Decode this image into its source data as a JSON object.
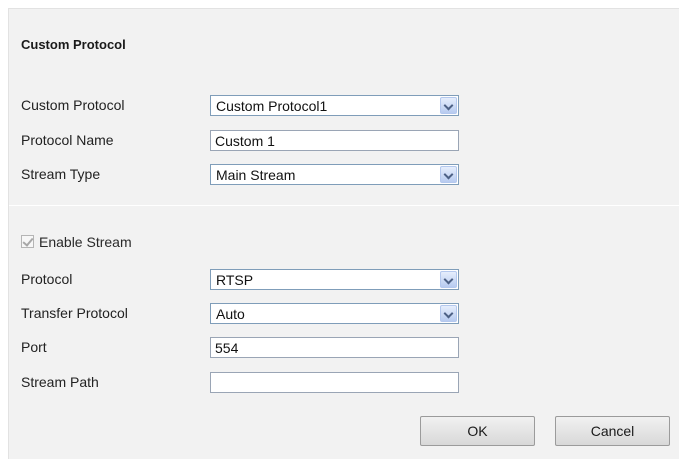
{
  "section_title": "Custom Protocol",
  "custom_protocol": {
    "label": "Custom Protocol",
    "value": "Custom Protocol1"
  },
  "protocol_name": {
    "label": "Protocol Name",
    "value": "Custom 1"
  },
  "stream_type": {
    "label": "Stream Type",
    "value": "Main Stream"
  },
  "enable_stream": {
    "label": "Enable Stream",
    "checked": true,
    "disabled": true
  },
  "protocol": {
    "label": "Protocol",
    "value": "RTSP"
  },
  "transfer_protocol": {
    "label": "Transfer Protocol",
    "value": "Auto"
  },
  "port": {
    "label": "Port",
    "value": "554"
  },
  "stream_path": {
    "label": "Stream Path",
    "value": ""
  },
  "buttons": {
    "ok": "OK",
    "cancel": "Cancel"
  },
  "colors": {
    "panel_bg": "#f2f2f2",
    "input_border": "#7f9db9",
    "dropdown_arrow": "#b7cbf0"
  },
  "icons": {
    "dropdown": "chevron-down-icon",
    "checkbox": "checkmark-icon"
  }
}
